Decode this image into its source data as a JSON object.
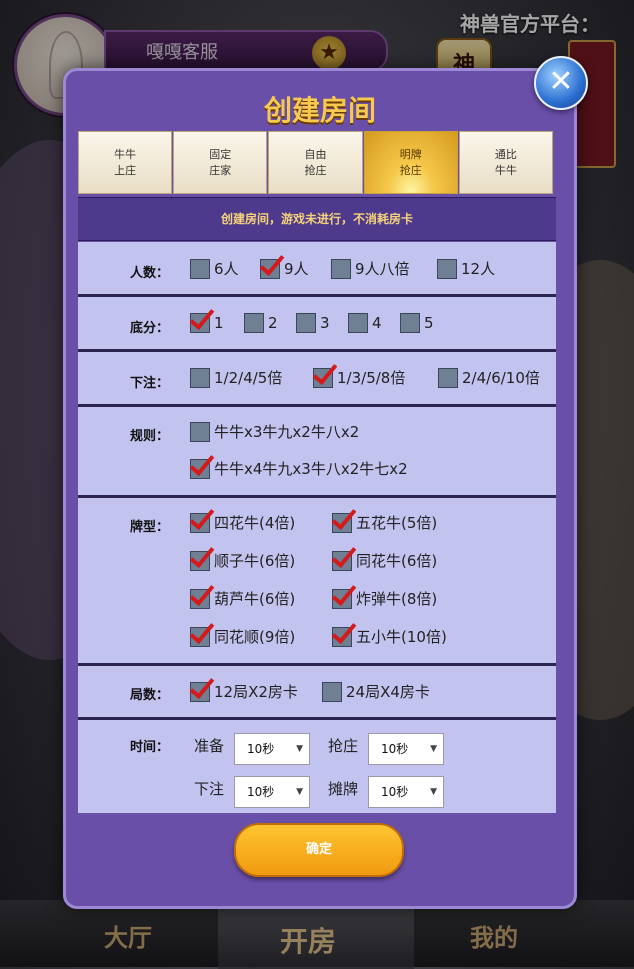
{
  "header": {
    "username": "嘎嘎客服",
    "marquee": "神兽官方平台：",
    "badge": "神"
  },
  "bottom_nav": [
    "大厅",
    "开房",
    "我的"
  ],
  "dialog": {
    "title": "创建房间",
    "close_label": "✕",
    "tabs": [
      "牛牛\n上庄",
      "固定\n庄家",
      "自由\n抢庄",
      "明牌\n抢庄",
      "通比\n牛牛"
    ],
    "active_tab": 3,
    "notice": "创建房间，游戏未进行，不消耗房卡",
    "confirm_label": "确定",
    "rows": {
      "players": {
        "label": "人数：",
        "options": [
          {
            "text": "6人",
            "checked": false
          },
          {
            "text": "9人",
            "checked": true
          },
          {
            "text": "9人八倍",
            "checked": false
          },
          {
            "text": "12人",
            "checked": false
          }
        ]
      },
      "base": {
        "label": "底分：",
        "options": [
          {
            "text": "1",
            "checked": true
          },
          {
            "text": "2",
            "checked": false
          },
          {
            "text": "3",
            "checked": false
          },
          {
            "text": "4",
            "checked": false
          },
          {
            "text": "5",
            "checked": false
          }
        ]
      },
      "bet": {
        "label": "下注：",
        "options": [
          {
            "text": "1/2/4/5倍",
            "checked": false
          },
          {
            "text": "1/3/5/8倍",
            "checked": true
          },
          {
            "text": "2/4/6/10倍",
            "checked": false
          }
        ]
      },
      "rules": {
        "label": "规则：",
        "options": [
          {
            "text": "牛牛x3牛九x2牛八x2",
            "checked": false
          },
          {
            "text": "牛牛x4牛九x3牛八x2牛七x2",
            "checked": true
          }
        ]
      },
      "card_types": {
        "label": "牌型：",
        "options": [
          {
            "text": "四花牛(4倍)",
            "checked": true
          },
          {
            "text": "五花牛(5倍)",
            "checked": true
          },
          {
            "text": "顺子牛(6倍)",
            "checked": true
          },
          {
            "text": "同花牛(6倍)",
            "checked": true
          },
          {
            "text": "葫芦牛(6倍)",
            "checked": true
          },
          {
            "text": "炸弹牛(8倍)",
            "checked": true
          },
          {
            "text": "同花顺(9倍)",
            "checked": true
          },
          {
            "text": "五小牛(10倍)",
            "checked": true
          }
        ]
      },
      "rounds": {
        "label": "局数：",
        "options": [
          {
            "text": "12局X2房卡",
            "checked": true
          },
          {
            "text": "24局X4房卡",
            "checked": false
          }
        ]
      },
      "time": {
        "label": "时间：",
        "selects": [
          {
            "label": "准备",
            "value": "10秒"
          },
          {
            "label": "抢庄",
            "value": "10秒"
          },
          {
            "label": "下注",
            "value": "10秒"
          },
          {
            "label": "摊牌",
            "value": "10秒"
          }
        ],
        "caret": "▼"
      }
    }
  },
  "colors": {
    "accent": "#f7c94e",
    "dialog_bg": "#6a4fa8",
    "panel_bg": "#c3c3f0",
    "check_mark": "#d41a1a",
    "confirm": "#f5a91f"
  }
}
